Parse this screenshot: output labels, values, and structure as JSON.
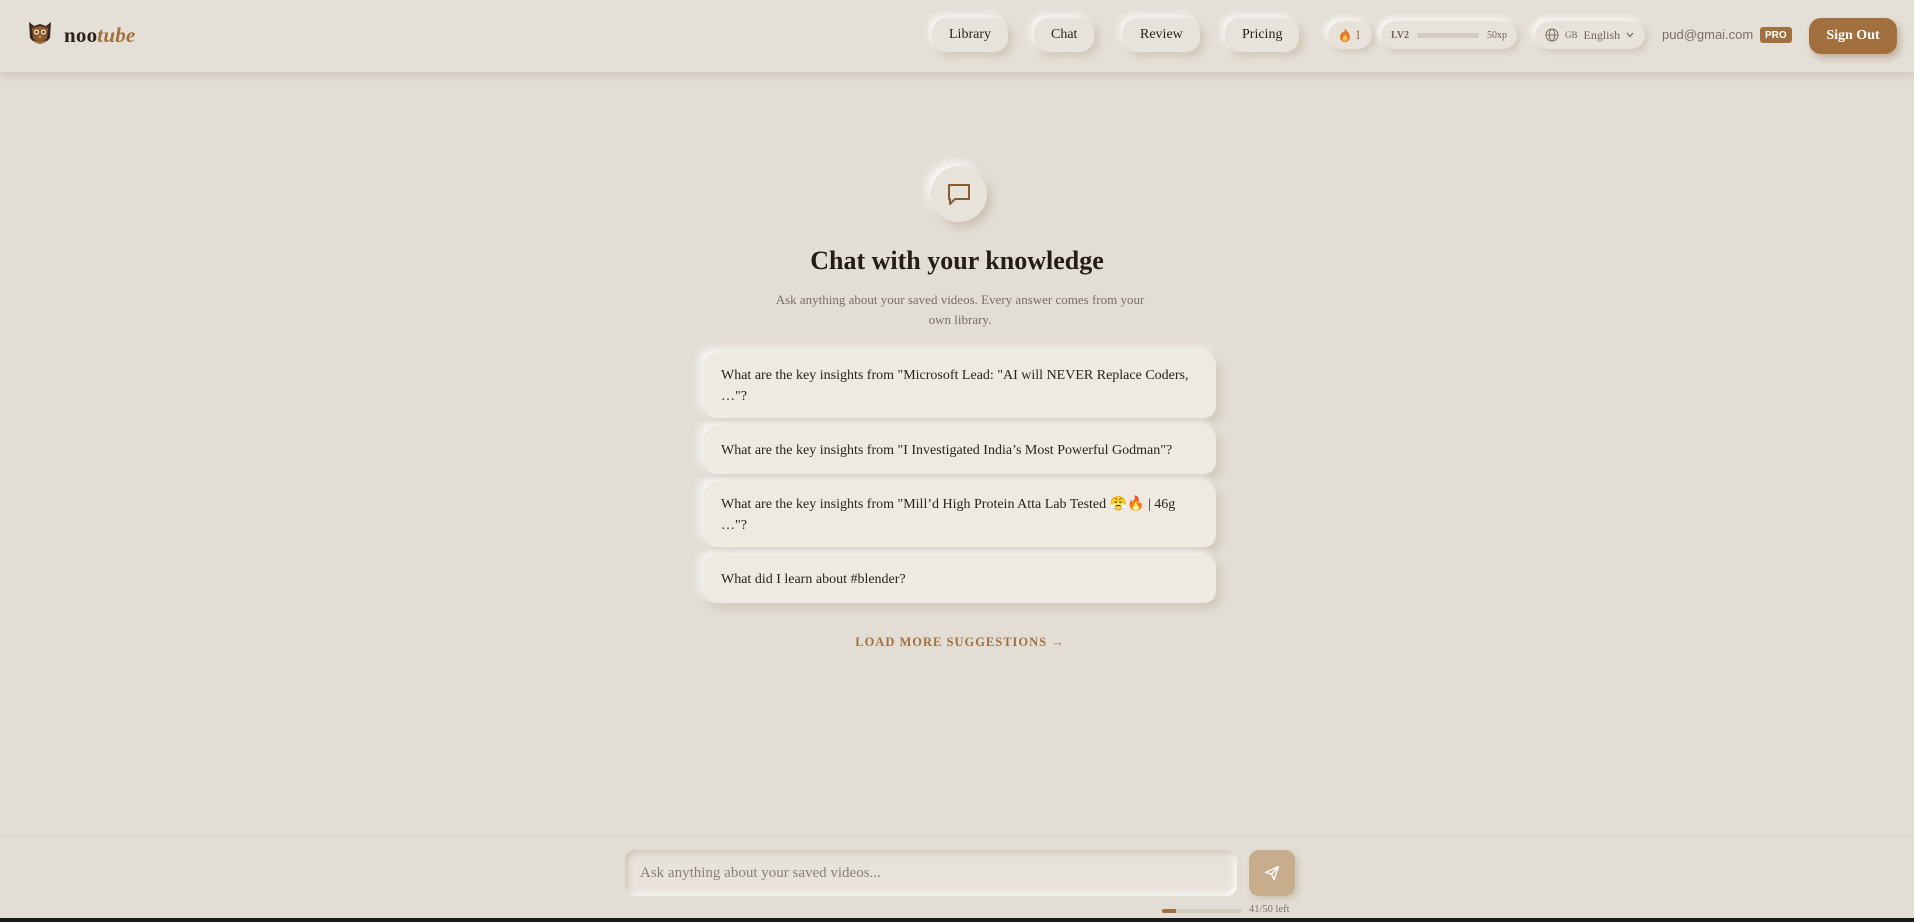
{
  "app": {
    "name_prefix": "noo",
    "name_suffix": "tube"
  },
  "nav": {
    "items": [
      {
        "label": "Library"
      },
      {
        "label": "Chat"
      },
      {
        "label": "Review"
      },
      {
        "label": "Pricing"
      }
    ]
  },
  "stats": {
    "streak_icon": "fire-icon",
    "streak": "1",
    "level_label": "LV2",
    "xp_label": "50xp",
    "xp_progress": 0.0
  },
  "language": {
    "flag": "GB",
    "label": "English",
    "icon": "globe-icon"
  },
  "account": {
    "email": "pud@gmai.com",
    "plan_badge": "PRO",
    "sign_out_label": "Sign Out"
  },
  "hero": {
    "icon": "chat-bubble-icon",
    "title": "Chat with your knowledge",
    "subtitle": "Ask anything about your saved videos. Every answer comes from your own library."
  },
  "suggestions": [
    "What are the key insights from \"Microsoft Lead: \"AI will NEVER Replace Coders, …\"?",
    "What are the key insights from \"I Investigated India’s Most Powerful Godman\"?",
    "What are the key insights from \"Mill’d High Protein Atta Lab Tested 😤🔥 | 46g …\"?",
    "What did I learn about #blender?"
  ],
  "load_more_label": "LOAD MORE SUGGESTIONS →",
  "chat_input": {
    "placeholder": "Ask anything about your saved videos...",
    "value": ""
  },
  "quota": {
    "text": "41/50 left",
    "used_fraction": 0.18
  },
  "colors": {
    "accent": "#a2703f",
    "background": "#e3ded5",
    "send_button": "#c8ad8d"
  }
}
